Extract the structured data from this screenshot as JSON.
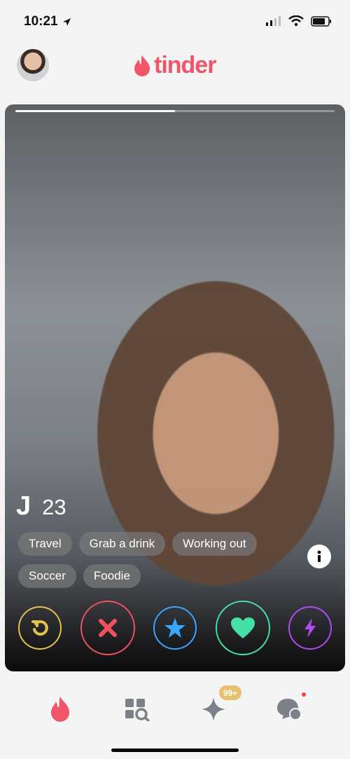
{
  "status_bar": {
    "time": "10:21",
    "signal_icon": "signal-icon",
    "wifi_icon": "wifi-icon",
    "battery_icon": "battery-icon"
  },
  "header": {
    "logo_text": "tinder",
    "profile_icon": "avatar-icon",
    "brand_color": "#f0556a"
  },
  "profile": {
    "name": "J",
    "age": "23",
    "photo_progress": 0.5,
    "interests": [
      "Travel",
      "Grab a drink",
      "Working out",
      "Soccer",
      "Foodie"
    ]
  },
  "actions": [
    {
      "name": "rewind",
      "icon": "rewind-icon",
      "color": "#e7c24a"
    },
    {
      "name": "nope",
      "icon": "x-icon",
      "color": "#f05161"
    },
    {
      "name": "super-like",
      "icon": "star-icon",
      "color": "#3aa5ff"
    },
    {
      "name": "like",
      "icon": "heart-icon",
      "color": "#45e0a5"
    },
    {
      "name": "boost",
      "icon": "bolt-icon",
      "color": "#b04cf0"
    }
  ],
  "bottom_nav": {
    "badge": "99+"
  }
}
